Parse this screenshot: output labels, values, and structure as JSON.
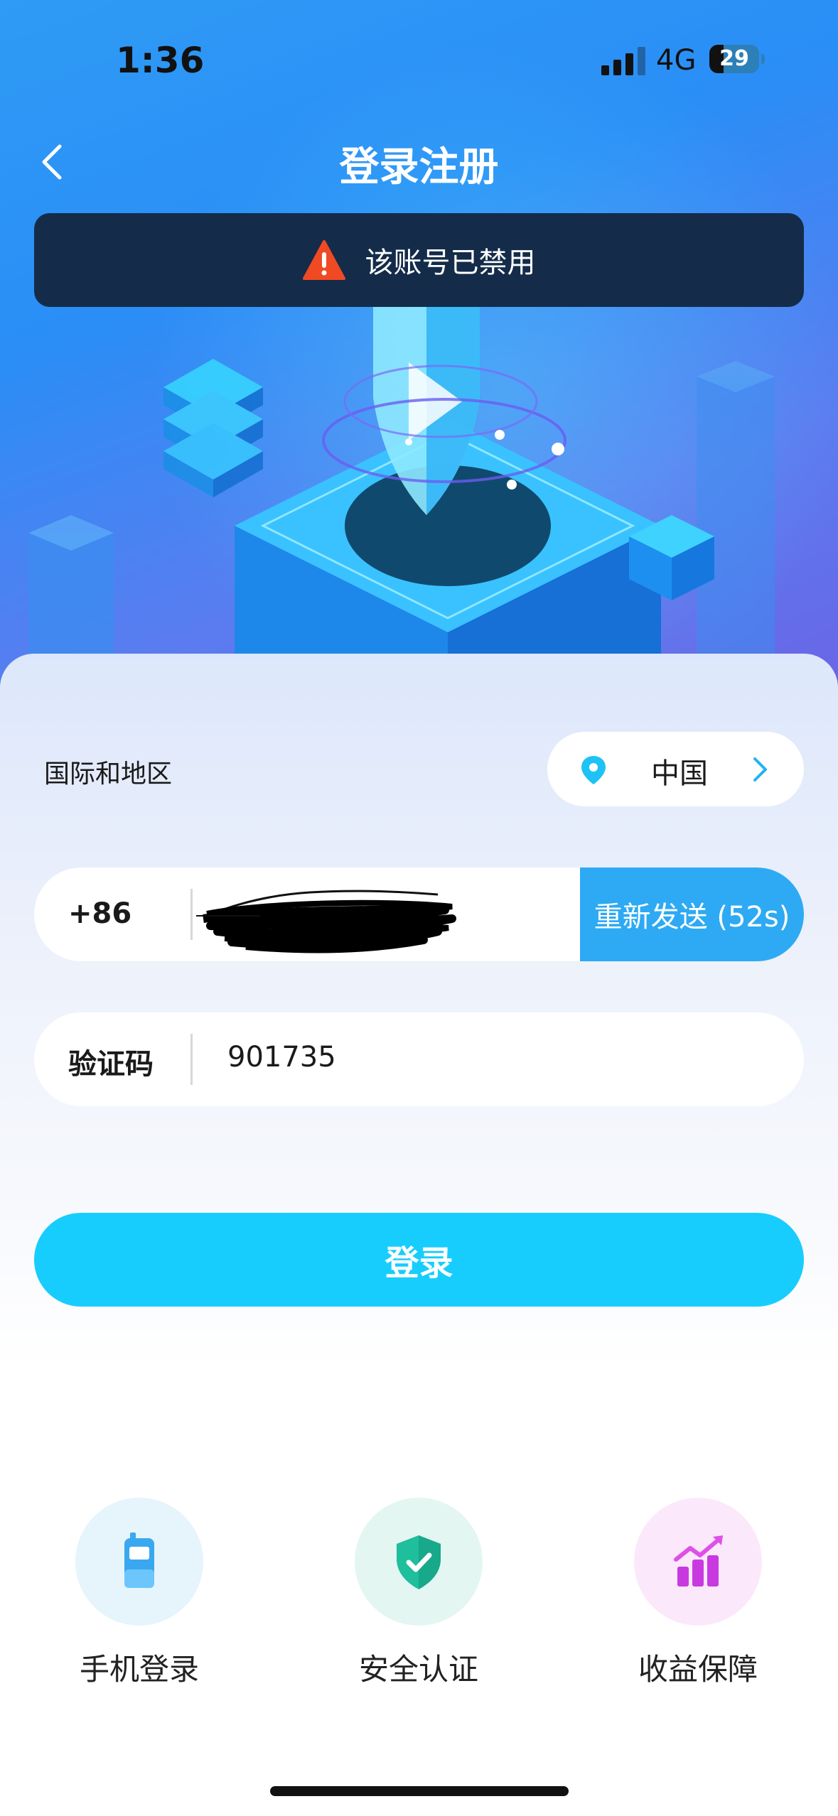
{
  "status_bar": {
    "time": "1:36",
    "network": "4G",
    "battery": "29"
  },
  "header": {
    "title": "登录注册"
  },
  "alert": {
    "text": "该账号已禁用"
  },
  "region": {
    "label": "国际和地区",
    "value": "中国"
  },
  "phone": {
    "prefix": "+86",
    "resend_label": "重新发送 (52s)"
  },
  "code": {
    "label": "验证码",
    "value": "901735"
  },
  "login_button": "登录",
  "features": [
    {
      "label": "手机登录",
      "icon": "phone-icon"
    },
    {
      "label": "安全认证",
      "icon": "shield-check-icon"
    },
    {
      "label": "收益保障",
      "icon": "chart-icon"
    }
  ],
  "colors": {
    "accent": "#17cdfd",
    "resend": "#2daaf3",
    "alert_bg": "#142c49",
    "warning": "#f04a24"
  }
}
